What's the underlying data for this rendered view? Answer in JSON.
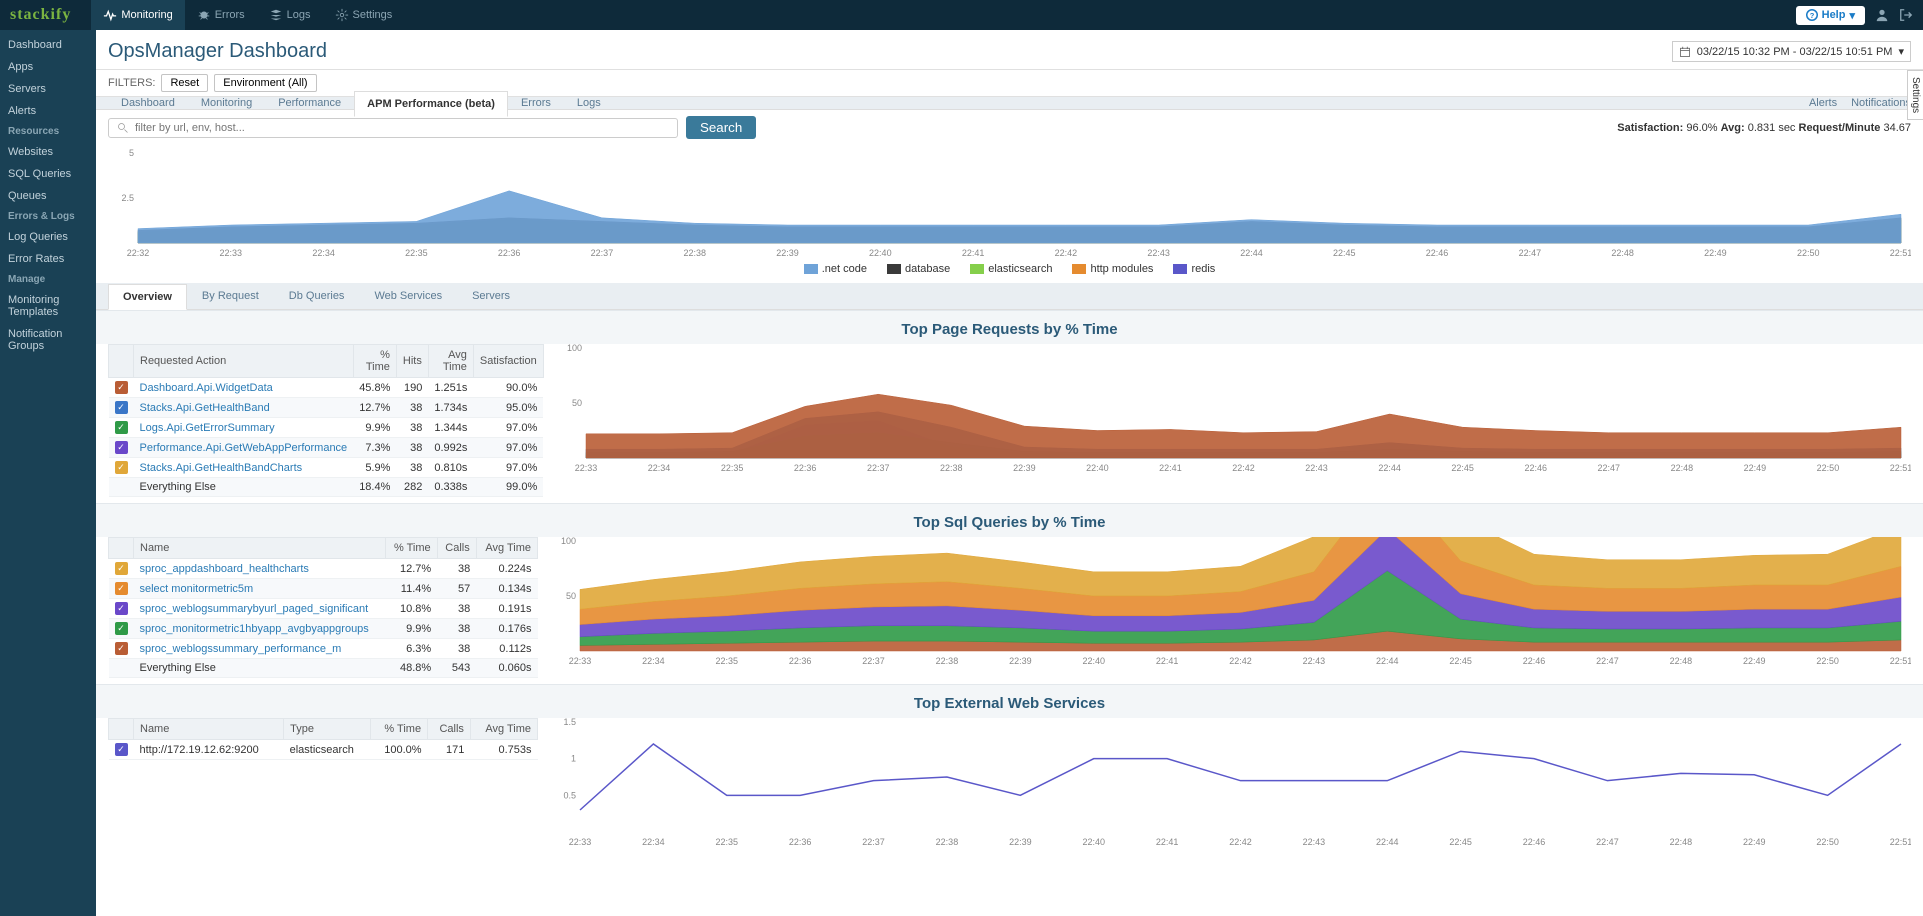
{
  "brand": "stackify",
  "topnav": {
    "monitoring": "Monitoring",
    "errors": "Errors",
    "logs": "Logs",
    "settings": "Settings",
    "help": "Help",
    "help_arrow": "▾"
  },
  "sidebar": {
    "main": [
      "Dashboard",
      "Apps",
      "Servers",
      "Alerts"
    ],
    "resources_head": "Resources",
    "resources": [
      "Websites",
      "SQL Queries",
      "Queues"
    ],
    "errors_head": "Errors & Logs",
    "errors": [
      "Log Queries",
      "Error Rates"
    ],
    "manage_head": "Manage",
    "manage": [
      "Monitoring Templates",
      "Notification Groups"
    ]
  },
  "page": {
    "title": "OpsManager Dashboard",
    "date_range": "03/22/15 10:32 PM - 03/22/15 10:51 PM",
    "settings_tab": "Settings"
  },
  "filters": {
    "label": "FILTERS:",
    "reset": "Reset",
    "env": "Environment (All)"
  },
  "tabs": {
    "items": [
      "Dashboard",
      "Monitoring",
      "Performance",
      "APM Performance (beta)",
      "Errors",
      "Logs"
    ],
    "right": [
      "Alerts",
      "Notifications"
    ]
  },
  "search": {
    "placeholder": "filter by url, env, host...",
    "button": "Search"
  },
  "metrics": {
    "sat_label": "Satisfaction:",
    "sat": "96.0%",
    "avg_label": "Avg:",
    "avg": "0.831",
    "avg_unit": "sec",
    "rpm_label": "Request/Minute",
    "rpm": "34.67"
  },
  "subtabs": [
    "Overview",
    "By Request",
    "Db Queries",
    "Web Services",
    "Servers"
  ],
  "chart_data": [
    {
      "type": "area",
      "title": "",
      "ylim": [
        0,
        5
      ],
      "yticks": [
        2.5,
        5
      ],
      "x": [
        "22:32",
        "22:33",
        "22:34",
        "22:35",
        "22:36",
        "22:37",
        "22:38",
        "22:39",
        "22:40",
        "22:41",
        "22:42",
        "22:43",
        "22:44",
        "22:45",
        "22:46",
        "22:47",
        "22:48",
        "22:49",
        "22:50",
        "22:51"
      ],
      "series": [
        {
          "name": ".net code",
          "color": "#6fa3d8",
          "values": [
            0.8,
            1.0,
            1.1,
            1.2,
            2.9,
            1.4,
            1.1,
            1.0,
            1.0,
            1.0,
            1.0,
            1.0,
            1.3,
            1.1,
            1.0,
            1.0,
            1.0,
            1.0,
            1.0,
            1.6
          ]
        },
        {
          "name": "database",
          "color": "#3a3a3a",
          "values": [
            0.7,
            0.9,
            1.0,
            1.1,
            1.4,
            1.2,
            1.0,
            0.9,
            0.9,
            0.9,
            0.9,
            0.9,
            1.2,
            1.0,
            0.9,
            0.9,
            0.9,
            0.9,
            0.9,
            1.4
          ]
        },
        {
          "name": "elasticsearch",
          "color": "#85cf4b",
          "values": [
            0.6,
            0.8,
            0.9,
            1.0,
            1.3,
            1.1,
            0.9,
            0.8,
            0.8,
            0.8,
            0.8,
            0.8,
            1.1,
            0.9,
            0.8,
            0.8,
            0.8,
            0.8,
            0.8,
            1.3
          ]
        },
        {
          "name": "http modules",
          "color": "#e58b2f",
          "values": [
            0.05,
            0.06,
            0.06,
            0.07,
            0.12,
            0.08,
            0.06,
            0.05,
            0.05,
            0.05,
            0.05,
            0.05,
            0.07,
            0.06,
            0.05,
            0.05,
            0.05,
            0.05,
            0.05,
            0.09
          ]
        },
        {
          "name": "redis",
          "color": "#5a57c9",
          "values": [
            0.04,
            0.05,
            0.05,
            0.06,
            0.1,
            0.07,
            0.05,
            0.04,
            0.04,
            0.04,
            0.04,
            0.04,
            0.06,
            0.05,
            0.04,
            0.04,
            0.04,
            0.04,
            0.04,
            0.08
          ]
        }
      ]
    },
    {
      "type": "area",
      "title": "Top Page Requests by % Time",
      "ylim": [
        0,
        100
      ],
      "yticks": [
        50,
        100
      ],
      "x": [
        "22:33",
        "22:34",
        "22:35",
        "22:36",
        "22:37",
        "22:38",
        "22:39",
        "22:40",
        "22:41",
        "22:42",
        "22:43",
        "22:44",
        "22:45",
        "22:46",
        "22:47",
        "22:48",
        "22:49",
        "22:50",
        "22:51"
      ],
      "series": [
        {
          "name": "Dashboard.Api.WidgetData",
          "color": "#b95d35",
          "values": [
            22,
            22,
            23,
            47,
            58,
            48,
            29,
            25,
            26,
            23,
            24,
            40,
            28,
            25,
            23,
            23,
            23,
            23,
            28
          ]
        },
        {
          "name": "Stacks.Api.GetHealthBand",
          "color": "#3a76c7",
          "values": [
            8,
            8,
            9,
            36,
            42,
            28,
            10,
            8,
            8,
            8,
            8,
            14,
            9,
            8,
            8,
            8,
            8,
            8,
            9
          ]
        },
        {
          "name": "Logs.Api.GetErrorSummary",
          "color": "#2f9a47",
          "values": [
            5,
            5,
            6,
            20,
            23,
            14,
            6,
            5,
            5,
            5,
            5,
            8,
            6,
            5,
            5,
            5,
            5,
            5,
            6
          ]
        },
        {
          "name": "Performance.Api.GetWebAppPerformance",
          "color": "#6a48c9",
          "values": [
            3,
            3,
            4,
            30,
            34,
            10,
            4,
            3,
            3,
            3,
            3,
            5,
            4,
            3,
            3,
            3,
            3,
            3,
            4
          ]
        },
        {
          "name": "Stacks.Api.GetHealthBandCharts",
          "color": "#e0a739",
          "values": [
            2,
            2,
            2,
            7,
            8,
            5,
            2,
            2,
            2,
            2,
            2,
            3,
            2,
            2,
            2,
            2,
            2,
            2,
            2
          ]
        }
      ]
    },
    {
      "type": "area",
      "title": "Top Sql Queries by % Time",
      "ylim": [
        0,
        100
      ],
      "yticks": [
        50,
        100
      ],
      "x": [
        "22:33",
        "22:34",
        "22:35",
        "22:36",
        "22:37",
        "22:38",
        "22:39",
        "22:40",
        "22:41",
        "22:42",
        "22:43",
        "22:44",
        "22:45",
        "22:46",
        "22:47",
        "22:48",
        "22:49",
        "22:50",
        "22:51"
      ],
      "series": [
        {
          "name": "sproc_appdashboard_healthcharts",
          "color": "#e0a739",
          "values": [
            18,
            20,
            22,
            24,
            25,
            26,
            24,
            22,
            22,
            23,
            32,
            58,
            38,
            28,
            26,
            26,
            27,
            28,
            36
          ]
        },
        {
          "name": "select monitormetric5m",
          "color": "#e58b2f",
          "values": [
            14,
            16,
            18,
            20,
            21,
            22,
            20,
            18,
            18,
            19,
            26,
            48,
            30,
            22,
            21,
            21,
            22,
            22,
            28
          ]
        },
        {
          "name": "sproc_weblogsummarybyurl_paged_significant",
          "color": "#6a48c9",
          "values": [
            11,
            13,
            14,
            16,
            17,
            18,
            16,
            14,
            14,
            15,
            20,
            38,
            23,
            17,
            16,
            16,
            17,
            17,
            22
          ]
        },
        {
          "name": "sproc_monitormetric1hbyapp_avgbyappgroups",
          "color": "#2f9a47",
          "values": [
            8,
            10,
            11,
            13,
            14,
            14,
            13,
            11,
            11,
            12,
            16,
            55,
            18,
            13,
            12,
            12,
            13,
            13,
            17
          ]
        },
        {
          "name": "sproc_weblogsummary_performance_m",
          "color": "#b95d35",
          "values": [
            5,
            6,
            7,
            8,
            9,
            9,
            8,
            7,
            7,
            8,
            10,
            18,
            11,
            8,
            8,
            8,
            8,
            8,
            10
          ]
        }
      ]
    },
    {
      "type": "line",
      "title": "Top External Web Services",
      "ylim": [
        0,
        1.5
      ],
      "yticks": [
        0.5,
        1,
        1.5
      ],
      "x": [
        "22:33",
        "22:34",
        "22:35",
        "22:36",
        "22:37",
        "22:38",
        "22:39",
        "22:40",
        "22:41",
        "22:42",
        "22:43",
        "22:44",
        "22:45",
        "22:46",
        "22:47",
        "22:48",
        "22:49",
        "22:50",
        "22:51"
      ],
      "series": [
        {
          "name": "http://172.19.12.62:9200",
          "color": "#5a57c9",
          "values": [
            0.3,
            1.2,
            0.5,
            0.5,
            0.7,
            0.75,
            0.5,
            1.0,
            1.0,
            0.7,
            0.7,
            0.7,
            1.1,
            1.0,
            0.7,
            0.8,
            0.78,
            0.5,
            1.2
          ]
        }
      ]
    }
  ],
  "sections": {
    "s1": {
      "title": "Top Page Requests by % Time",
      "headers": {
        "a": "Requested Action",
        "t": "% Time",
        "h": "Hits",
        "avg": "Avg Time",
        "sat": "Satisfaction"
      },
      "rows": [
        {
          "chk": "#b95d35",
          "name": "Dashboard.Api.WidgetData",
          "pct": "45.8%",
          "hits": "190",
          "avg": "1.251s",
          "sat": "90.0%"
        },
        {
          "chk": "#3a76c7",
          "name": "Stacks.Api.GetHealthBand",
          "pct": "12.7%",
          "hits": "38",
          "avg": "1.734s",
          "sat": "95.0%"
        },
        {
          "chk": "#2f9a47",
          "name": "Logs.Api.GetErrorSummary",
          "pct": "9.9%",
          "hits": "38",
          "avg": "1.344s",
          "sat": "97.0%"
        },
        {
          "chk": "#6a48c9",
          "name": "Performance.Api.GetWebAppPerformance",
          "pct": "7.3%",
          "hits": "38",
          "avg": "0.992s",
          "sat": "97.0%"
        },
        {
          "chk": "#e0a739",
          "name": "Stacks.Api.GetHealthBandCharts",
          "pct": "5.9%",
          "hits": "38",
          "avg": "0.810s",
          "sat": "97.0%"
        },
        {
          "chk": "",
          "name": "Everything Else",
          "pct": "18.4%",
          "hits": "282",
          "avg": "0.338s",
          "sat": "99.0%",
          "plain": true
        }
      ]
    },
    "s2": {
      "title": "Top Sql Queries by % Time",
      "headers": {
        "n": "Name",
        "t": "% Time",
        "c": "Calls",
        "avg": "Avg Time"
      },
      "rows": [
        {
          "chk": "#e0a739",
          "name": "sproc_appdashboard_healthcharts",
          "pct": "12.7%",
          "calls": "38",
          "avg": "0.224s"
        },
        {
          "chk": "#e58b2f",
          "name": "select monitormetric5m",
          "pct": "11.4%",
          "calls": "57",
          "avg": "0.134s"
        },
        {
          "chk": "#6a48c9",
          "name": "sproc_weblogsummarybyurl_paged_significant",
          "pct": "10.8%",
          "calls": "38",
          "avg": "0.191s"
        },
        {
          "chk": "#2f9a47",
          "name": "sproc_monitormetric1hbyapp_avgbyappgroups",
          "pct": "9.9%",
          "calls": "38",
          "avg": "0.176s"
        },
        {
          "chk": "#b95d35",
          "name": "sproc_weblogssummary_performance_m",
          "pct": "6.3%",
          "calls": "38",
          "avg": "0.112s"
        },
        {
          "chk": "",
          "name": "Everything Else",
          "pct": "48.8%",
          "calls": "543",
          "avg": "0.060s",
          "plain": true
        }
      ]
    },
    "s3": {
      "title": "Top External Web Services",
      "headers": {
        "n": "Name",
        "ty": "Type",
        "t": "% Time",
        "c": "Calls",
        "avg": "Avg Time"
      },
      "rows": [
        {
          "chk": "#5a57c9",
          "name": "http://172.19.12.62:9200",
          "type": "elasticsearch",
          "pct": "100.0%",
          "calls": "171",
          "avg": "0.753s",
          "plain": true
        }
      ]
    }
  }
}
